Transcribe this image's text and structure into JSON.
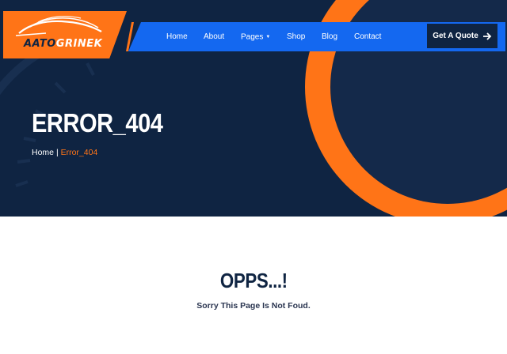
{
  "brand": {
    "logo_text_primary": "AATO",
    "logo_text_accent": "GRINEK",
    "logo_icon": "car-swoosh-icon",
    "colors": {
      "navy": "#0f2442",
      "orange": "#ff7417",
      "blue": "#1468f0"
    }
  },
  "nav": {
    "items": [
      {
        "label": "Home"
      },
      {
        "label": "About"
      },
      {
        "label": "Pages"
      },
      {
        "label": "Shop"
      },
      {
        "label": "Blog"
      },
      {
        "label": "Contact"
      }
    ],
    "cta_label": "Get A Quote",
    "cta_icon": "arrow-right-icon"
  },
  "hero": {
    "title": "ERROR_404",
    "breadcrumb": {
      "home": "Home",
      "separator": "|",
      "current": "Error_404"
    }
  },
  "error": {
    "title": "OPPS...!",
    "message": "Sorry This Page Is Not Foud."
  }
}
